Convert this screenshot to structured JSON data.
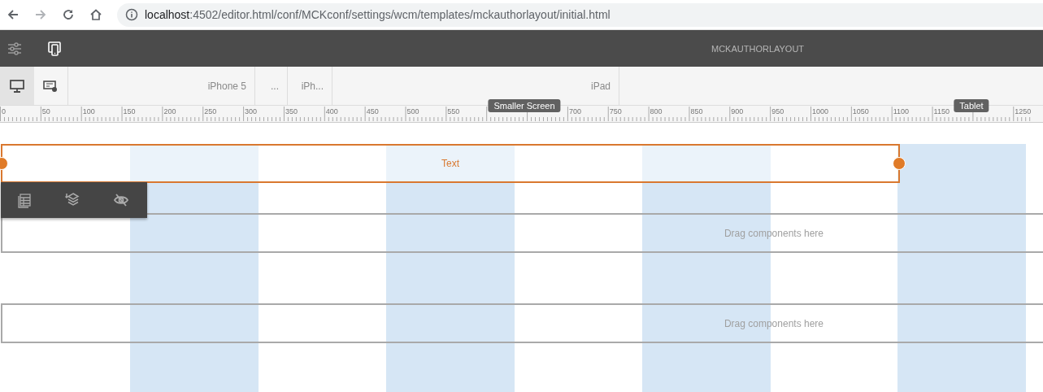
{
  "browser": {
    "url_host": "localhost",
    "url_path": ":4502/editor.html/conf/MCKconf/settings/wcm/templates/mckauthorlayout/initial.html"
  },
  "toolbar": {
    "title": "MCKAUTHORLAYOUT"
  },
  "device_modes": [
    {
      "kind": "desktop",
      "selected": true
    },
    {
      "kind": "emulator",
      "selected": false
    }
  ],
  "devices": [
    {
      "label": "iPhone 5"
    },
    {
      "label": "..."
    },
    {
      "label": "iPh..."
    },
    {
      "label": "iPad"
    }
  ],
  "ruler": {
    "labels": [
      "0",
      "50",
      "100",
      "150",
      "200",
      "250",
      "300",
      "350",
      "400",
      "450",
      "500",
      "550",
      "700",
      "750",
      "800",
      "850",
      "900",
      "950",
      "1000",
      "1050",
      "1100",
      "1150",
      "1250"
    ]
  },
  "breakpoints": [
    {
      "label": "Smaller Screen"
    },
    {
      "label": "Tablet"
    }
  ],
  "components": [
    {
      "kind": "text",
      "label": "Text",
      "selected": true
    },
    {
      "kind": "dropzone",
      "label": "Drag components here"
    },
    {
      "kind": "dropzone",
      "label": "Drag components here"
    }
  ]
}
